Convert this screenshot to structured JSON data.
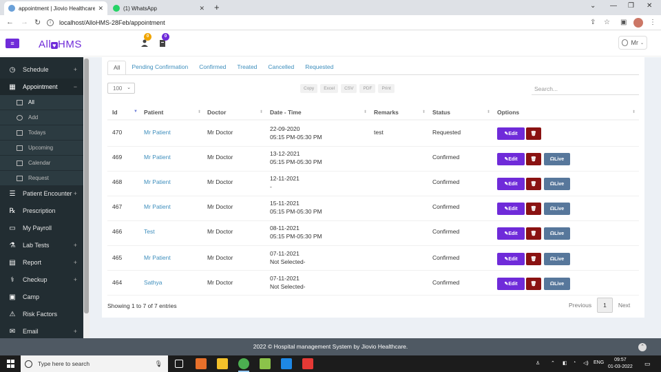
{
  "browser": {
    "tabs": [
      {
        "title": "appointment | Jiovio Healthcare (",
        "active": true
      },
      {
        "title": "(1) WhatsApp",
        "active": false
      }
    ],
    "url": "localhost/AlloHMS-28Feb/appointment"
  },
  "header": {
    "logo_text": "AllHMS",
    "logo_left": "All",
    "logo_heart": "♥",
    "logo_right": "HMS",
    "badge_users": "0",
    "badge_orders": "0",
    "user_name": "Mr"
  },
  "sidebar": {
    "items": [
      {
        "label": "Schedule",
        "icon": "clock-icon",
        "expandable": true
      },
      {
        "label": "Appointment",
        "icon": "calendar-check-icon",
        "expandable": true,
        "open": true
      },
      {
        "label": "Patient Encounter",
        "icon": "list-icon",
        "expandable": true
      },
      {
        "label": "Prescription",
        "icon": "rx-icon",
        "expandable": false
      },
      {
        "label": "My Payroll",
        "icon": "wallet-icon",
        "expandable": false
      },
      {
        "label": "Lab Tests",
        "icon": "flask-icon",
        "expandable": true
      },
      {
        "label": "Report",
        "icon": "report-icon",
        "expandable": true
      },
      {
        "label": "Checkup",
        "icon": "stethoscope-icon",
        "expandable": true
      },
      {
        "label": "Camp",
        "icon": "camp-icon",
        "expandable": false
      },
      {
        "label": "Risk Factors",
        "icon": "warning-icon",
        "expandable": false
      },
      {
        "label": "Email",
        "icon": "email-icon",
        "expandable": true
      }
    ],
    "appointment_sub": [
      {
        "label": "All",
        "active": true
      },
      {
        "label": "Add",
        "active": false
      },
      {
        "label": "Todays",
        "active": false
      },
      {
        "label": "Upcoming",
        "active": false
      },
      {
        "label": "Calendar",
        "active": false
      },
      {
        "label": "Request",
        "active": false
      }
    ]
  },
  "filter_tabs": [
    "All",
    "Pending Confirmation",
    "Confirmed",
    "Treated",
    "Cancelled",
    "Requested"
  ],
  "table_controls": {
    "page_length": "100",
    "export_buttons": [
      "Copy",
      "Excel",
      "CSV",
      "PDF",
      "Print"
    ],
    "search_placeholder": "Search..."
  },
  "table": {
    "columns": [
      "Id",
      "Patient",
      "Doctor",
      "Date - Time",
      "Remarks",
      "Status",
      "Options"
    ],
    "rows": [
      {
        "id": "470",
        "patient": "Mr Patient",
        "doctor": "Mr Doctor",
        "date": "22-09-2020",
        "time": "05:15 PM-05:30 PM",
        "remarks": "test",
        "status": "Requested",
        "live": false
      },
      {
        "id": "469",
        "patient": "Mr Patient",
        "doctor": "Mr Doctor",
        "date": "13-12-2021",
        "time": "05:15 PM-05:30 PM",
        "remarks": "",
        "status": "Confirmed",
        "live": true
      },
      {
        "id": "468",
        "patient": "Mr Patient",
        "doctor": "Mr Doctor",
        "date": "12-11-2021",
        "time": "-",
        "remarks": "",
        "status": "Confirmed",
        "live": true
      },
      {
        "id": "467",
        "patient": "Mr Patient",
        "doctor": "Mr Doctor",
        "date": "15-11-2021",
        "time": "05:15 PM-05:30 PM",
        "remarks": "",
        "status": "Confirmed",
        "live": true
      },
      {
        "id": "466",
        "patient": "Test",
        "doctor": "Mr Doctor",
        "date": "08-11-2021",
        "time": "05:15 PM-05:30 PM",
        "remarks": "",
        "status": "Confirmed",
        "live": true
      },
      {
        "id": "465",
        "patient": "Mr Patient",
        "doctor": "Mr Doctor",
        "date": "07-11-2021",
        "time": "Not Selected-",
        "remarks": "",
        "status": "Confirmed",
        "live": true
      },
      {
        "id": "464",
        "patient": "Sathya",
        "doctor": "Mr Doctor",
        "date": "07-11-2021",
        "time": "Not Selected-",
        "remarks": "",
        "status": "Confirmed",
        "live": true
      }
    ],
    "edit_label": "Edit",
    "live_label": "Live"
  },
  "table_info": "Showing 1 to 7 of 7 entries",
  "pagination": {
    "previous": "Previous",
    "current": "1",
    "next": "Next"
  },
  "footer": "2022 © Hospital management System by Jiovio Healthcare.",
  "taskbar": {
    "search_placeholder": "Type here to search",
    "language": "ENG",
    "time": "09:57",
    "date": "01-03-2022"
  },
  "colors": {
    "accent": "#6f2bd9",
    "danger": "#8a1212",
    "live": "#57779b",
    "sidebar": "#222d32"
  }
}
